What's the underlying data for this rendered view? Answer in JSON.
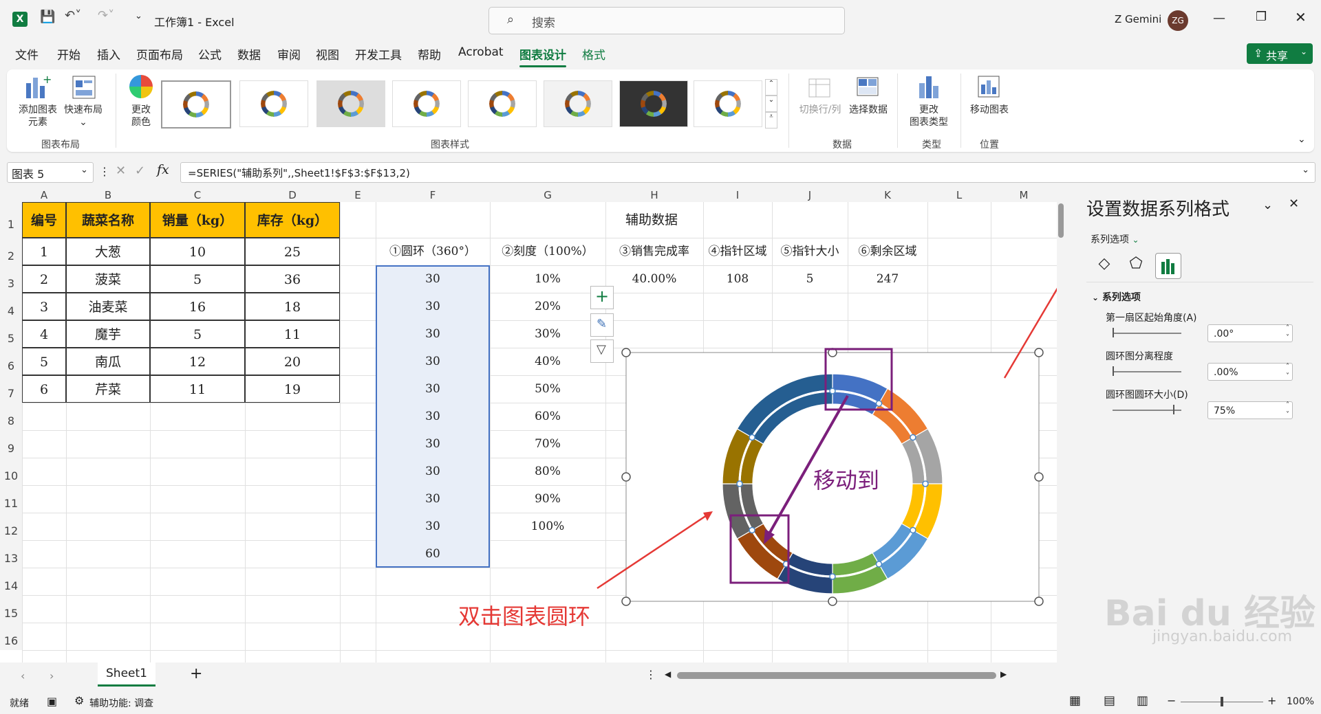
{
  "titlebar": {
    "doc_title": "工作簿1 - Excel",
    "search_placeholder": "搜索",
    "user_name": "Z Gemini",
    "user_initials": "ZG"
  },
  "tabs": [
    "文件",
    "开始",
    "插入",
    "页面布局",
    "公式",
    "数据",
    "审阅",
    "视图",
    "开发工具",
    "帮助",
    "Acrobat",
    "图表设计",
    "格式"
  ],
  "share_label": "共享",
  "ribbon": {
    "add_element": "添加图表\n元素",
    "quick_layout": "快速布局",
    "change_color": "更改\n颜色",
    "group_layout": "图表布局",
    "group_styles": "图表样式",
    "switch_rowcol": "切换行/列",
    "select_data": "选择数据",
    "group_data": "数据",
    "change_type": "更改\n图表类型",
    "group_type": "类型",
    "move_chart": "移动图表",
    "group_location": "位置"
  },
  "namebox": "图表 5",
  "formula": "=SERIES(\"辅助系列\",,Sheet1!$F$3:$F$13,2)",
  "columns": [
    "A",
    "B",
    "C",
    "D",
    "E",
    "F",
    "G",
    "H",
    "I",
    "J",
    "K",
    "L",
    "M"
  ],
  "rows": [
    "1",
    "2",
    "3",
    "4",
    "5",
    "6",
    "7",
    "8",
    "9",
    "10",
    "11",
    "12",
    "13",
    "14",
    "15",
    "16"
  ],
  "table1": {
    "headers": [
      "编号",
      "蔬菜名称",
      "销量（kg）",
      "库存（kg）"
    ],
    "rows": [
      [
        "1",
        "大葱",
        "10",
        "25"
      ],
      [
        "2",
        "菠菜",
        "5",
        "36"
      ],
      [
        "3",
        "油麦菜",
        "16",
        "18"
      ],
      [
        "4",
        "魔芋",
        "5",
        "11"
      ],
      [
        "5",
        "南瓜",
        "12",
        "20"
      ],
      [
        "6",
        "芹菜",
        "11",
        "19"
      ]
    ]
  },
  "aux": {
    "title": "辅助数据",
    "headers": [
      "①圆环（360°）",
      "②刻度（100%）",
      "③销售完成率",
      "④指针区域",
      "⑤指针大小",
      "⑥剩余区域"
    ],
    "f_values": [
      "30",
      "30",
      "30",
      "30",
      "30",
      "30",
      "30",
      "30",
      "30",
      "30",
      "60"
    ],
    "g_values": [
      "10%",
      "20%",
      "30%",
      "40%",
      "50%",
      "60%",
      "70%",
      "80%",
      "90%",
      "100%"
    ],
    "h3": "40.00%",
    "i3": "108",
    "j3": "5",
    "k3": "247"
  },
  "chart_data": {
    "type": "donut",
    "outer_ring": {
      "values": [
        30,
        30,
        30,
        30,
        30,
        30,
        30,
        30,
        30,
        30,
        60
      ],
      "colors": [
        "#4472c4",
        "#ed7d31",
        "#a5a5a5",
        "#ffc000",
        "#5b9bd5",
        "#70ad47",
        "#264478",
        "#9e480e",
        "#636363",
        "#997300",
        "#255e91"
      ]
    },
    "inner_ring": {
      "values": [
        30,
        30,
        30,
        30,
        30,
        30,
        30,
        30,
        30,
        30,
        60
      ]
    }
  },
  "annotations": {
    "move_to": "移动到",
    "double_click": "双击图表圆环"
  },
  "pane": {
    "title": "设置数据系列格式",
    "options_menu": "系列选项",
    "section": "系列选项",
    "angle_label": "第一扇区起始角度(A)",
    "angle_value": ".00°",
    "explosion_label": "圆环图分离程度",
    "explosion_value": ".00%",
    "hole_label": "圆环图圆环大小(D)",
    "hole_value": "75%"
  },
  "sheet_tab": "Sheet1",
  "status": {
    "ready": "就绪",
    "accessibility": "辅助功能: 调查",
    "zoom": "100%"
  },
  "watermark": {
    "brand": "Bai du 经验",
    "url": "jingyan.baidu.com"
  }
}
